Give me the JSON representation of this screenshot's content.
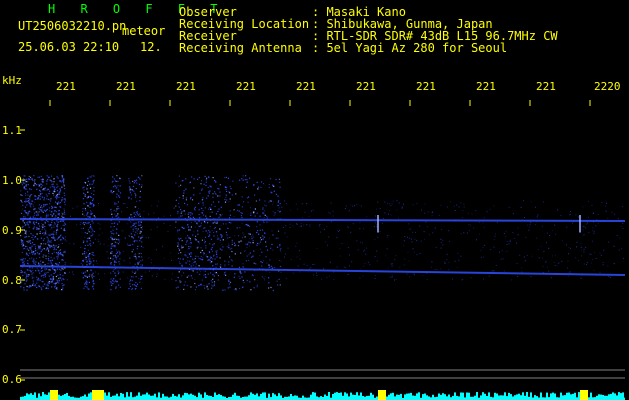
{
  "header": {
    "software": "H R O F F T",
    "filename": "UT2506032210.pn",
    "meteor_label": "meteor",
    "datetime": "25.06.03 22:10",
    "count": "12.",
    "fields": [
      {
        "label": "Observer",
        "value": ": Masaki Kano"
      },
      {
        "label": "Receiving Location",
        "value": ": Shibukawa, Gunma, Japan"
      },
      {
        "label": "Receiver",
        "value": ": RTL-SDR SDR# 43dB L15 96.7MHz CW"
      },
      {
        "label": "Receiving Antenna",
        "value": ": 5el Yagi Az 280 for Seoul"
      }
    ]
  },
  "axes": {
    "y_unit": "kHz",
    "y_ticks": [
      "1.1",
      "1.0",
      "0.9",
      "0.8",
      "0.7",
      "0.6"
    ],
    "y_tick_values": [
      1.1,
      1.0,
      0.9,
      0.8,
      0.7,
      0.6
    ],
    "x_ticks": [
      "221",
      "221",
      "221",
      "221",
      "221",
      "221",
      "221",
      "221",
      "221",
      "2220"
    ],
    "y_range": [
      0.58,
      1.14
    ]
  },
  "colors": {
    "background": "#000000",
    "text": "#ffff00",
    "title": "#00ff00",
    "signal": "#3050ff",
    "signal_bright": "#a0b0ff",
    "level_bar": "#00ffff",
    "level_peak": "#ffff00",
    "grid": "#808080"
  },
  "carriers": [
    {
      "freq_start": 0.828,
      "freq_end": 0.81
    },
    {
      "freq_start": 0.922,
      "freq_end": 0.918
    }
  ]
}
